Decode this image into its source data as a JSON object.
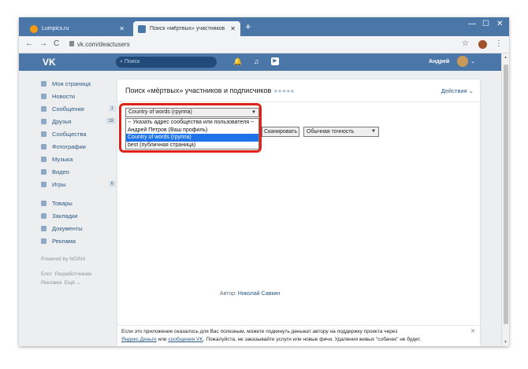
{
  "browser": {
    "tab1_title": "Lumpics.ru",
    "tab2_title": "Поиск «мёртвых» участников ",
    "url": "vk.com/deactusers",
    "new_tab": "+",
    "tab_close": "✕",
    "back": "←",
    "forward": "→",
    "reload": "C",
    "star": "☆",
    "menu": "⋮",
    "min": "—",
    "max": "☐",
    "close": "✕",
    "colors": {
      "titlebar": "#4a76a8",
      "accent": "#4a76a8"
    }
  },
  "vk": {
    "logo": "VK",
    "search_placeholder": "Поиск",
    "user_name": "Андрей",
    "bell": "🔔",
    "music": "♫",
    "play": "▶"
  },
  "sidebar": {
    "items": [
      {
        "label": "Моя страница",
        "badge": ""
      },
      {
        "label": "Новости",
        "badge": ""
      },
      {
        "label": "Сообщения",
        "badge": "1"
      },
      {
        "label": "Друзья",
        "badge": "18"
      },
      {
        "label": "Сообщества",
        "badge": ""
      },
      {
        "label": "Фотографии",
        "badge": ""
      },
      {
        "label": "Музыка",
        "badge": ""
      },
      {
        "label": "Видео",
        "badge": ""
      },
      {
        "label": "Игры",
        "badge": "6"
      }
    ],
    "items2": [
      {
        "label": "Товары"
      },
      {
        "label": "Закладки"
      },
      {
        "label": "Документы"
      },
      {
        "label": "Реклама"
      }
    ],
    "powered": "Powered by NGINX",
    "footer_links": [
      "Блог",
      "Разработчикам",
      "Реклама",
      "Ещё ⌄"
    ]
  },
  "main": {
    "title": "Поиск «мёртвых» участников и подписчиков",
    "stars": "★★★★★",
    "actions": "Действия ⌄",
    "select_value": "Country of words (группа)",
    "dropdown_arrow": "▼",
    "options": [
      "-- Указать адрес сообщества или пользователя --",
      "Андрей Петров (Ваш профиль)",
      "Country of words (группа)",
      "best (публичная страница)"
    ],
    "selected_index": 2,
    "scan_button": "Сканировать",
    "accuracy_select": "Обычная точность",
    "note_text1": "Если это приложение оказалось для Вас полезным, можете подкинуть деньжат автору на поддержку проекта через",
    "note_link1": "Яндекс.Деньги",
    "note_or": " или ",
    "note_link2": "сообщения VK",
    "note_text2": ". Пожалуйста, не заказывайте услуги или новые фичи. Удаления живых \"собачек\" не будет.",
    "note_close": "✕",
    "author_label": "Автор: ",
    "author_name": "Николай Савкин"
  }
}
